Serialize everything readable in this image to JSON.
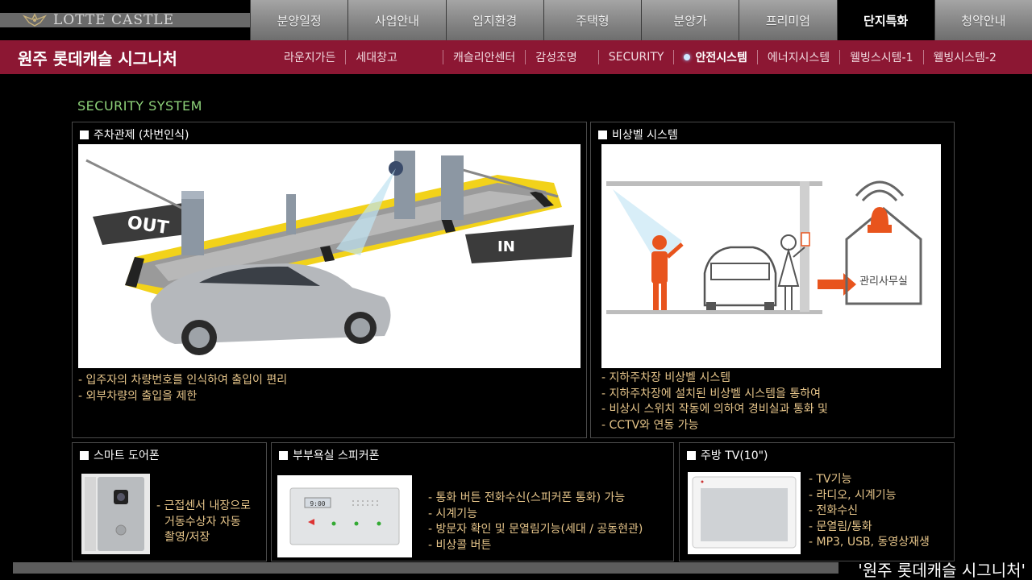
{
  "brand": {
    "logo_text": "LOTTE CASTLE"
  },
  "top_nav": [
    "분양일정",
    "사업안내",
    "입지환경",
    "주택형",
    "분양가",
    "프리미엄",
    "단지특화",
    "청약안내"
  ],
  "top_nav_active": "단지특화",
  "sub_header": {
    "title": "원주 롯데캐슬 시그니처",
    "items": [
      "라운지가든",
      "세대창고",
      "캐슬리안센터",
      "감성조명",
      "SECURITY",
      "안전시스템",
      "에너지시스템",
      "웰빙스시템-1",
      "웰빙시스템-2"
    ],
    "active": "안전시스템"
  },
  "section_title": "SECURITY SYSTEM",
  "panels": {
    "parking": {
      "title": "주차관제 (차번인식)",
      "lines": [
        "- 입주자의 차량번호를 인식하여 출입이 편리",
        "- 외부차량의 출입을 제한"
      ],
      "sign_out": "OUT",
      "sign_in": "IN"
    },
    "emergency": {
      "title": "비상벨 시스템",
      "lines": [
        "- 지하주차장 비상벨 시스템",
        "- 지하주차장에 설치된 비상벨 시스템을 통하여",
        "- 비상시 스위치 작동에 의하여 경비실과 통화 및",
        "- CCTV와 연동 가능"
      ],
      "office_label": "관리사무실"
    },
    "doorphone": {
      "title": "스마트 도어폰",
      "lines": [
        "- 근접센서 내장으로",
        "거동수상자 자동",
        "촬영/저장"
      ]
    },
    "bath_speaker": {
      "title": "부부욕실 스피커폰",
      "lines": [
        "- 통화 버튼 전화수신(스피커폰 통화) 가능",
        "- 시계기능",
        "- 방문자 확인 및 문열림기능(세대 / 공동현관)",
        "- 비상콜 버튼"
      ],
      "clock": "9:00"
    },
    "kitchen_tv": {
      "title": "주방 TV(10\")",
      "lines": [
        "- TV기능",
        "- 라디오, 시계기능",
        "- 전화수신",
        "- 문열림/통화",
        "- MP3, USB, 동영상재생"
      ]
    }
  },
  "bottom_caption": "'원주 롯데캐슬 시그니처'",
  "colors": {
    "brand": "#8c1733",
    "section_title": "#8ed27a",
    "desc_text": "#e6c58a",
    "accent_orange": "#e8541d"
  }
}
